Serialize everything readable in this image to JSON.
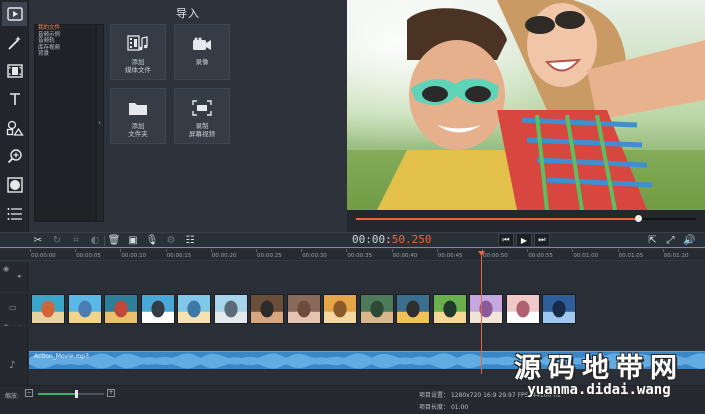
{
  "app": {
    "accent": "#e8663d",
    "timeline_accent": "#3ba0e0",
    "zoom_accent": "#38b56b"
  },
  "toolbar": {
    "tools": [
      {
        "icon": "import-icon",
        "active": true
      },
      {
        "icon": "magic-wand-icon",
        "active": false
      },
      {
        "icon": "film-strip-icon",
        "active": false
      },
      {
        "icon": "text-icon",
        "active": false
      },
      {
        "icon": "shapes-icon",
        "active": false
      },
      {
        "icon": "zoom-icon",
        "active": false
      },
      {
        "icon": "stabilize-icon",
        "active": false
      },
      {
        "icon": "menu-icon",
        "active": false
      }
    ]
  },
  "import": {
    "title": "导入",
    "categories": [
      {
        "label": "我的文件",
        "selected": true
      },
      {
        "label": "音频示例",
        "selected": false
      },
      {
        "label": "音频轨",
        "selected": false
      },
      {
        "label": "库存视频",
        "selected": false
      },
      {
        "label": "背景",
        "selected": false
      }
    ],
    "tiles": {
      "add_media": {
        "line1": "添加",
        "line2": "媒体文件",
        "icon": "add-media-icon"
      },
      "record": {
        "line1": "录像",
        "line2": "",
        "icon": "camera-icon"
      },
      "add_folder": {
        "line1": "添加",
        "line2": "文件夹",
        "icon": "folder-icon"
      },
      "screen_record": {
        "line1": "录制",
        "line2": "屏幕视频",
        "icon": "screen-capture-icon"
      }
    }
  },
  "preview": {
    "progress": 0.83
  },
  "edit_bar": {
    "tools": [
      "scissors-icon",
      "rotate-icon",
      "crop-icon",
      "color-icon",
      "trash-icon",
      "image-icon",
      "mic-icon",
      "gear-icon",
      "equalizer-icon"
    ],
    "timecode_main": "00:00:",
    "timecode_highlight": "50.250",
    "playback": [
      "prev-icon",
      "play-icon",
      "next-icon"
    ],
    "right": [
      "export-icon",
      "fullscreen-icon",
      "volume-icon"
    ]
  },
  "timeline": {
    "ticks": [
      "00:00:00",
      "00:00:05",
      "00:00:10",
      "00:00:15",
      "00:00:20",
      "00:00:25",
      "00:00:30",
      "00:00:35",
      "00:00:40",
      "00:00:45",
      "00:00:50",
      "00:00:55",
      "00:01:00",
      "00:01:05",
      "00:01:10"
    ],
    "clips": 15,
    "audio_label": "Action_Movie.mp3"
  },
  "status": {
    "zoom_label": "缩放:",
    "zoom_level": 0.58,
    "settings_label": "项目设置：",
    "settings_value": "1280x720 16:9 29.97 FPS, 44100 Hz",
    "length_label": "项目长度：",
    "length_value": "01:00"
  },
  "watermark": {
    "cn": "源码地带网",
    "en": "yuanma.didai.wang"
  }
}
